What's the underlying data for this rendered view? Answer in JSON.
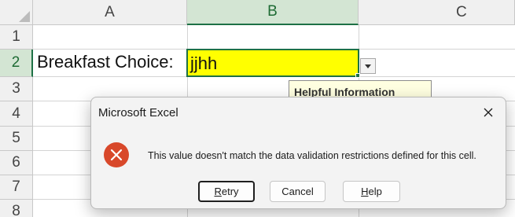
{
  "sheet": {
    "columns": [
      "A",
      "B",
      "C"
    ],
    "active_column": "B",
    "rows": [
      "1",
      "2",
      "3",
      "4",
      "5",
      "6",
      "7",
      "8"
    ],
    "active_row": "2",
    "cells": {
      "A2": "Breakfast Choice:",
      "B2": "jjhh"
    },
    "cell_fill_color": "#ffff00",
    "selection_color": "#1e7145"
  },
  "validation_input_message": {
    "title": "Helpful Information"
  },
  "dialog": {
    "title": "Microsoft Excel",
    "message": "This value doesn't match the data validation restrictions defined for this cell.",
    "icon": "error-icon",
    "buttons": {
      "retry": {
        "label_first": "R",
        "label_rest": "etry"
      },
      "cancel": {
        "label": "Cancel"
      },
      "help": {
        "label_first": "H",
        "label_rest": "elp"
      }
    }
  }
}
